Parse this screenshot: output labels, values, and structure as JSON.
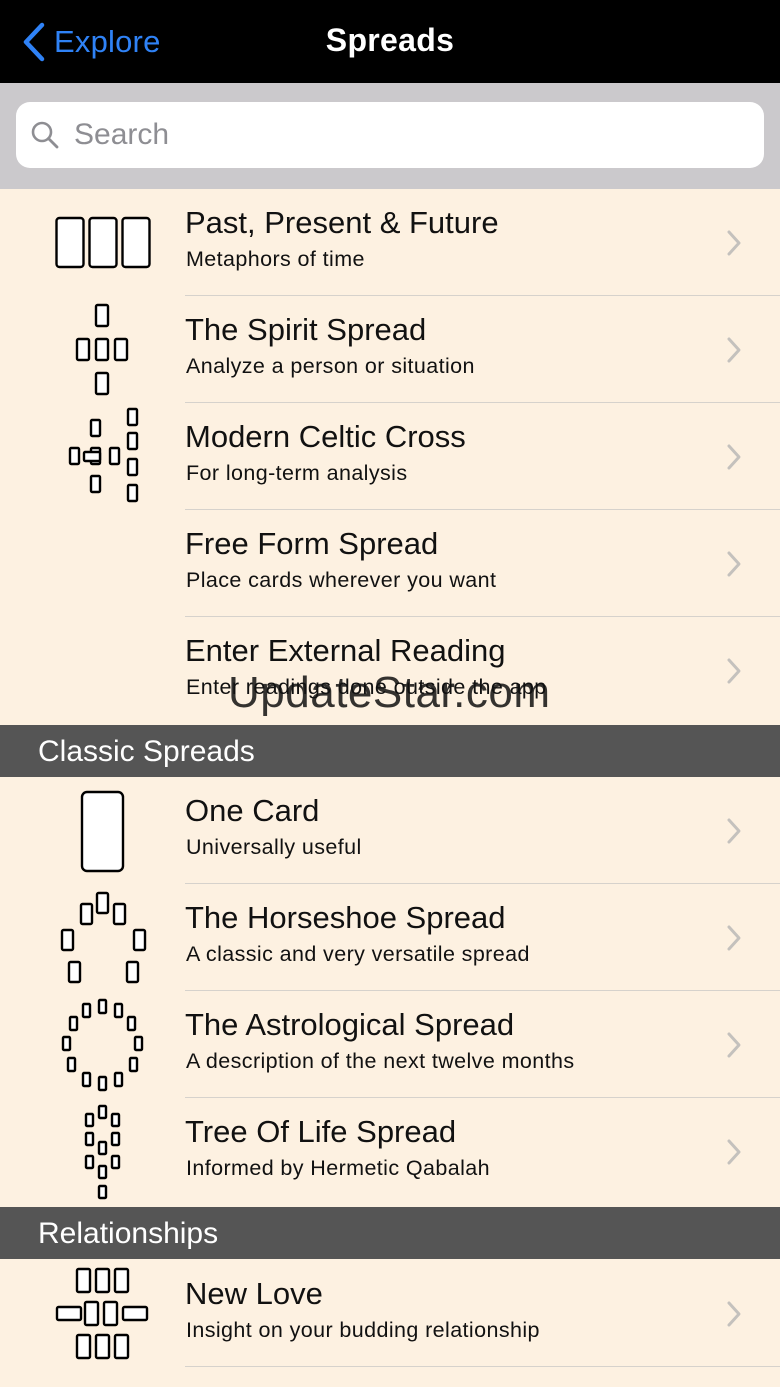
{
  "nav": {
    "back_label": "Explore",
    "title": "Spreads"
  },
  "search": {
    "placeholder": "Search",
    "value": ""
  },
  "colors": {
    "accent": "#2f82f6",
    "background": "#fdf1e1",
    "section_header": "#555555",
    "navbar": "#000000"
  },
  "sections": [
    {
      "header": "",
      "items": [
        {
          "title": "Past, Present & Future",
          "subtitle": "Metaphors of time",
          "icon": "three-card-row-icon"
        },
        {
          "title": "The Spirit Spread",
          "subtitle": "Analyze a person or situation",
          "icon": "spirit-cross-icon"
        },
        {
          "title": "Modern Celtic Cross",
          "subtitle": "For long-term analysis",
          "icon": "celtic-cross-icon"
        },
        {
          "title": "Free Form Spread",
          "subtitle": "Place cards wherever you want",
          "icon": ""
        },
        {
          "title": "Enter External Reading",
          "subtitle": "Enter readings done outside the app",
          "icon": ""
        }
      ]
    },
    {
      "header": "Classic Spreads",
      "items": [
        {
          "title": "One Card",
          "subtitle": "Universally useful",
          "icon": "single-card-icon"
        },
        {
          "title": "The Horseshoe Spread",
          "subtitle": "A classic and very versatile spread",
          "icon": "horseshoe-icon"
        },
        {
          "title": "The Astrological Spread",
          "subtitle": "A description of the next twelve months",
          "icon": "astrological-circle-icon"
        },
        {
          "title": "Tree Of Life Spread",
          "subtitle": "Informed by Hermetic Qabalah",
          "icon": "tree-of-life-icon"
        }
      ]
    },
    {
      "header": "Relationships",
      "items": [
        {
          "title": "New Love",
          "subtitle": "Insight on your budding relationship",
          "icon": "new-love-icon"
        }
      ]
    }
  ],
  "watermark": "UpdateStar.com"
}
